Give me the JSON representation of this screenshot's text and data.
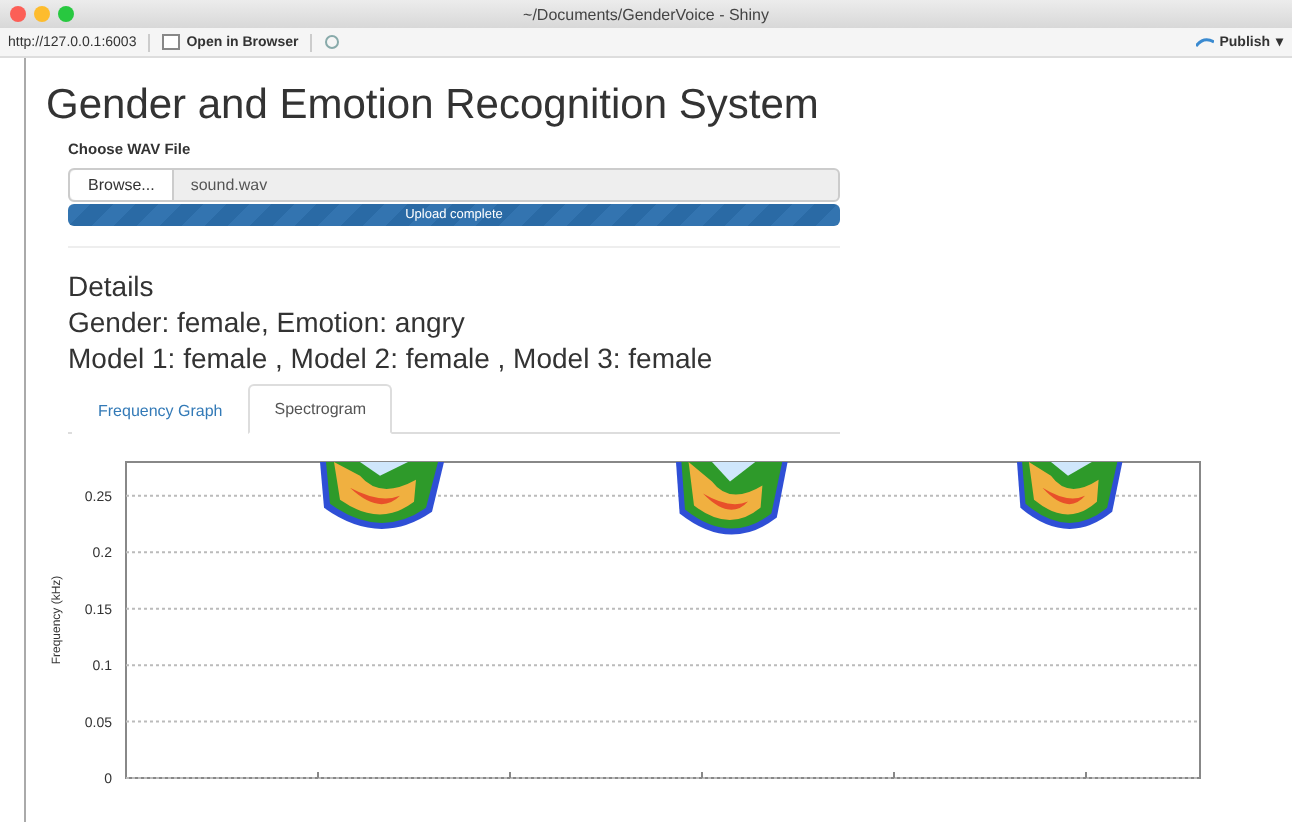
{
  "window": {
    "title": "~/Documents/GenderVoice - Shiny"
  },
  "toolbar": {
    "url": "http://127.0.0.1:6003",
    "open_in_browser": "Open in Browser",
    "publish": "Publish",
    "publish_caret": "▾"
  },
  "page": {
    "title": "Gender and Emotion Recognition System",
    "file_input": {
      "label": "Choose WAV File",
      "button": "Browse...",
      "value": "sound.wav",
      "progress_text": "Upload complete",
      "level": 1
    },
    "details": {
      "heading": "Details",
      "lines": [
        "Gender: female, Emotion: angry",
        "Model 1: female , Model 2: female , Model 3: female"
      ]
    },
    "tabs": [
      {
        "label": "Frequency Graph",
        "selected": false
      },
      {
        "label": "Spectrogram",
        "selected": true
      }
    ],
    "spectrogram": {
      "ylabel": "Frequency (kHz)",
      "yticks": [
        "0.25",
        "0.2",
        "0.15",
        "0.1",
        "0.05",
        "0"
      ]
    }
  }
}
